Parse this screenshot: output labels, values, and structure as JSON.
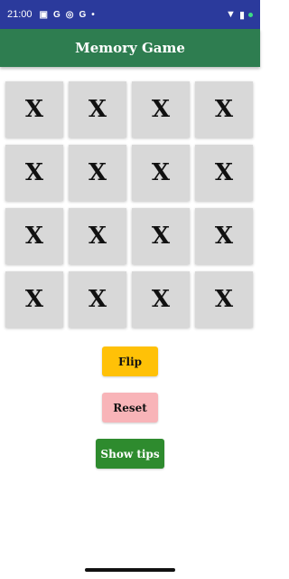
{
  "status_bar": {
    "time": "21:00",
    "icons": [
      "sim-icon",
      "google-icon",
      "target-icon",
      "google-icon",
      "dot-icon"
    ],
    "right_icons": [
      "wifi-icon",
      "battery-icon"
    ]
  },
  "app_bar": {
    "title": "Memory Game",
    "color": "#2e7d50"
  },
  "cards": [
    "X",
    "X",
    "X",
    "X",
    "X",
    "X",
    "X",
    "X",
    "X",
    "X",
    "X",
    "X",
    "X",
    "X",
    "X",
    "X"
  ],
  "buttons": {
    "flip": "Flip",
    "reset": "Reset",
    "tips": "Show tips"
  },
  "colors": {
    "flip": "#ffc107",
    "reset": "#f8b4b8",
    "tips": "#2e8b2e"
  }
}
